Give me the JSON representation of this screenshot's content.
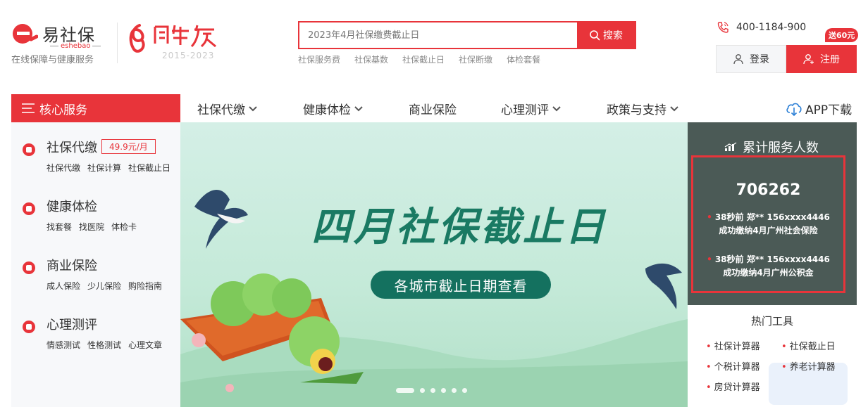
{
  "header": {
    "logo_name": "易社保",
    "logo_sub": "eshebao",
    "logo_slogan": "在线保障与健康服务",
    "anniversary_years": "2015-2023",
    "search": {
      "placeholder": "2023年4月社保缴费截止日",
      "button_label": "搜索"
    },
    "hot_words": [
      "社保服务费",
      "社保基数",
      "社保截止日",
      "社保断缴",
      "体检套餐"
    ],
    "hotline": "400-1184-900",
    "promo_tag": "送60元",
    "login_label": "登录",
    "register_label": "注册"
  },
  "nav": {
    "core_label": "核心服务",
    "items": [
      {
        "label": "社保代缴"
      },
      {
        "label": "健康体检"
      },
      {
        "label": "商业保险"
      },
      {
        "label": "心理测评"
      },
      {
        "label": "政策与支持"
      }
    ],
    "app_download": "APP下载"
  },
  "sidebar": {
    "services": [
      {
        "title": "社保代缴",
        "price": "49.9元/月",
        "links": [
          "社保代缴",
          "社保计算",
          "社保截止日"
        ]
      },
      {
        "title": "健康体检",
        "links": [
          "找套餐",
          "找医院",
          "体检卡"
        ]
      },
      {
        "title": "商业保险",
        "links": [
          "成人保险",
          "少儿保险",
          "购险指南"
        ]
      },
      {
        "title": "心理测评",
        "links": [
          "情感测试",
          "性格测试",
          "心理文章"
        ]
      }
    ]
  },
  "banner": {
    "title": "四月社保截止日",
    "cta": "各城市截止日期查看",
    "slides": 6,
    "active_slide": 1
  },
  "stats": {
    "title": "累计服务人数",
    "count": "706262",
    "feed": [
      {
        "line1": "38秒前 郑** 156xxxx4446",
        "line2": "成功缴纳4月广州社会保险"
      },
      {
        "line1": "38秒前 郑** 156xxxx4446",
        "line2": "成功缴纳4月广州公积金"
      }
    ]
  },
  "tools": {
    "title": "热门工具",
    "items": [
      "社保计算器",
      "社保截止日",
      "个税计算器",
      "养老计算器",
      "房贷计算器"
    ]
  },
  "colors": {
    "brand_red": "#e8343a",
    "banner_green": "#14715f",
    "stats_bg": "#4b5a56"
  }
}
